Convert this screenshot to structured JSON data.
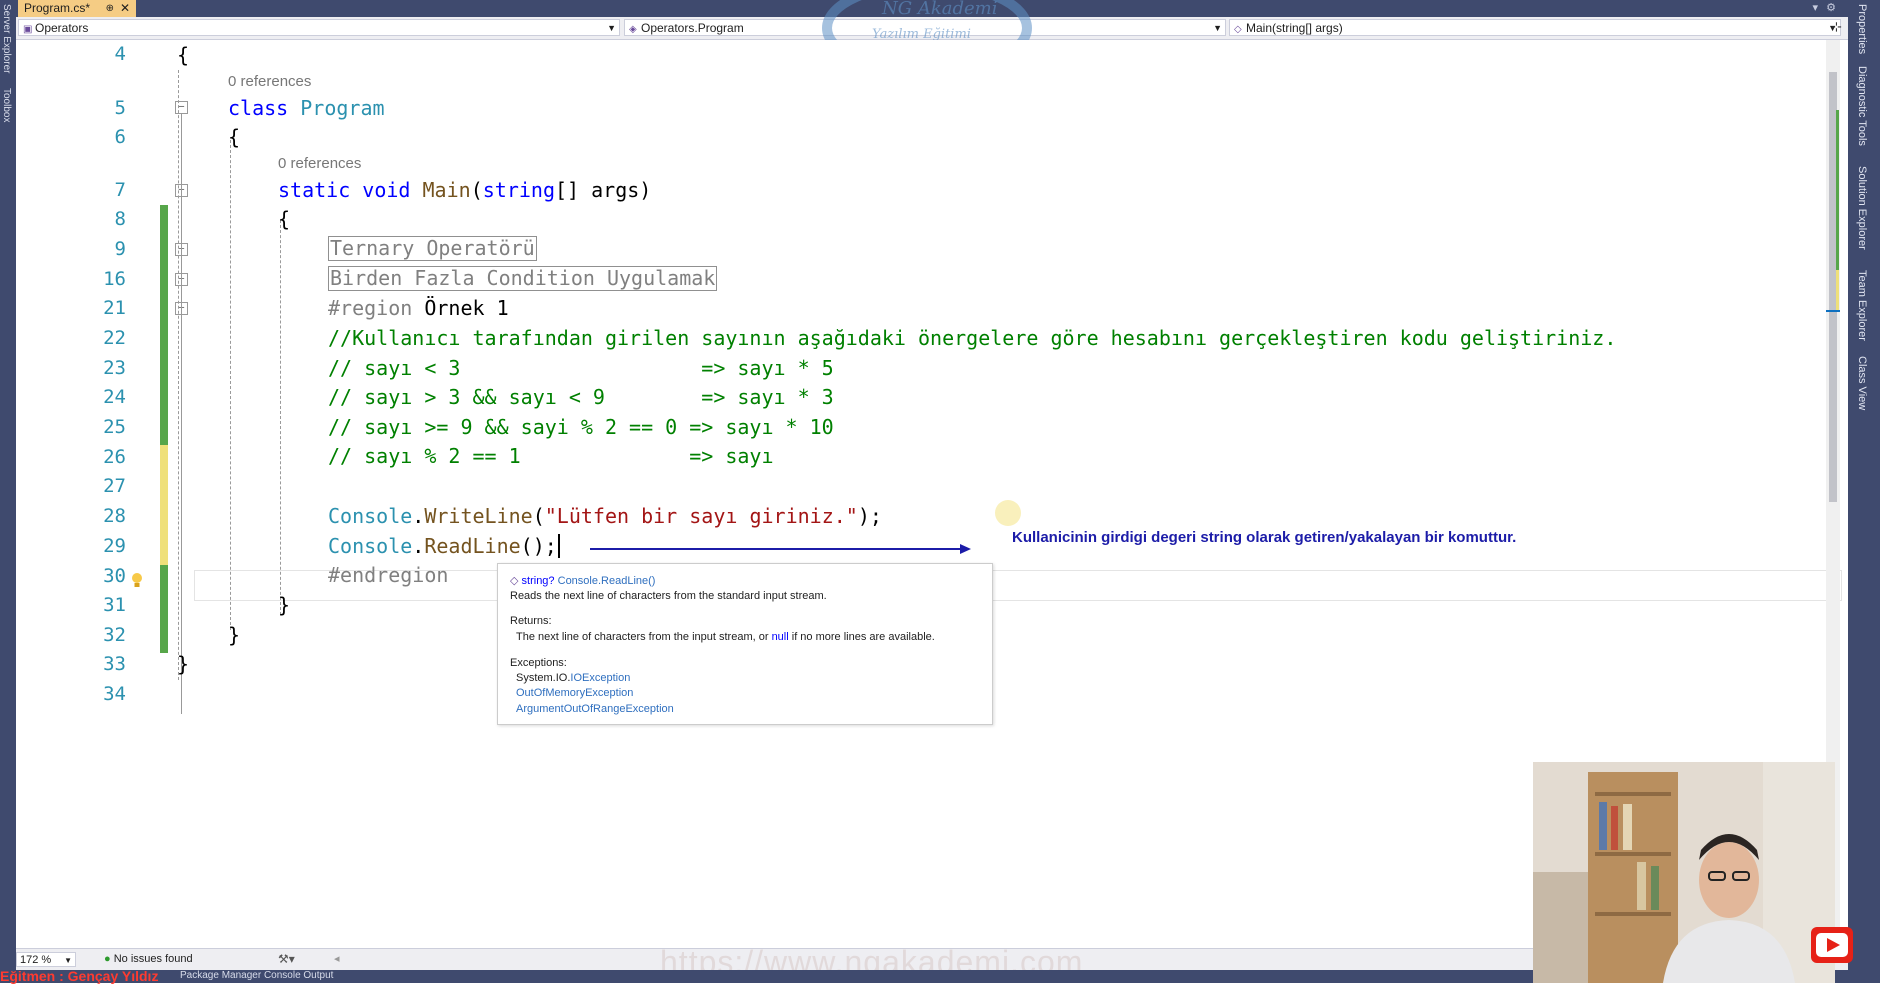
{
  "tab": {
    "title": "Program.cs*",
    "pin_icon": "pin-icon",
    "close_icon": "close-icon"
  },
  "navbar": {
    "project": "Operators",
    "class": "Operators.Program",
    "member": "Main(string[] args)"
  },
  "lines": {
    "n4": "4",
    "n5": "5",
    "n6": "6",
    "n7": "7",
    "n8": "8",
    "n9": "9",
    "n16": "16",
    "n21": "21",
    "n22": "22",
    "n23": "23",
    "n24": "24",
    "n25": "25",
    "n26": "26",
    "n27": "27",
    "n28": "28",
    "n29": "29",
    "n30": "30",
    "n31": "31",
    "n32": "32",
    "n33": "33",
    "n34": "34"
  },
  "code": {
    "refs_class": "0 references",
    "refs_main": "0 references",
    "brace_open": "{",
    "brace_close": "}",
    "kw_class": "class",
    "class_name": "Program",
    "kw_static": "static",
    "kw_void": "void",
    "main_name": "Main",
    "paren_open": "(",
    "kw_string": "string",
    "arr": "[] ",
    "args": "args",
    "paren_close": ")",
    "region1": "Ternary Operatörü",
    "region2": "Birden Fazla Condition Uygulamak",
    "region_kw": "#region",
    "region_name": " Örnek 1",
    "comment1": "//Kullanıcı tarafından girilen sayının aşağıdaki önergelere göre hesabını gerçekleştiren kodu geliştiriniz.",
    "comment2": "// sayı < 3                    => sayı * 5",
    "comment3": "// sayı > 3 && sayı < 9        => sayı * 3",
    "comment4": "// sayı >= 9 && sayi % 2 == 0 => sayı * 10",
    "comment5": "// sayı % 2 == 1              => sayı",
    "console": "Console",
    "dot": ".",
    "writeline": "WriteLine",
    "str": "\"Lütfen bir sayı giriniz.\"",
    "end_wl": ");",
    "readline": "ReadLine",
    "end_rl": "();",
    "endregion": "#endregion"
  },
  "tooltip": {
    "sig_type": "string?",
    "sig_method": "Console.ReadLine()",
    "summary": "Reads the next line of characters from the standard input stream.",
    "returns_label": "Returns:",
    "returns_text_a": "The next line of characters from the input stream, or ",
    "returns_null": "null",
    "returns_text_b": " if no more lines are available.",
    "exceptions_label": "Exceptions:",
    "ex1_prefix": "System.IO.",
    "ex1_name": "IOException",
    "ex2": "OutOfMemoryException",
    "ex3": "ArgumentOutOfRangeException"
  },
  "annotation": "Kullanicinin girdigi degeri string olarak getiren/yakalayan bir komuttur.",
  "status": {
    "zoom": "172 %",
    "issues": "No issues found"
  },
  "watermark": "https://www.ngakademi.com",
  "logo": {
    "line1": "NG Akademi",
    "line2": "Yazılım Eğitimi"
  },
  "right_panels": [
    "Properties",
    "Diagnostic Tools",
    "Solution Explorer",
    "Team Explorer",
    "Class View"
  ],
  "left_panels": [
    "Server Explorer",
    "Toolbox"
  ],
  "bottom": {
    "presenter": "Eğitmen : Gençay Yıldız",
    "tabs": "Package Manager Console   Output"
  },
  "colors": {
    "changed_green": "#57a64a",
    "changed_yellow": "#efe07a",
    "chrome": "#3f4a6e",
    "tab_active": "#f5cc84"
  }
}
